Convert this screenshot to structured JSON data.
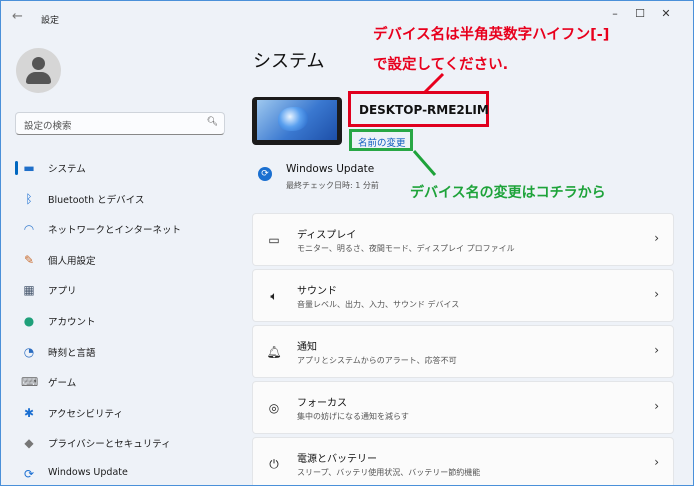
{
  "window": {
    "title": "設定",
    "controls": [
      "–",
      "☐",
      "✕"
    ]
  },
  "sidebar": {
    "search_placeholder": "設定の検索",
    "items": [
      {
        "label": "システム",
        "icon": "monitor-icon",
        "active": true
      },
      {
        "label": "Bluetooth とデバイス",
        "icon": "bluetooth-icon"
      },
      {
        "label": "ネットワークとインターネット",
        "icon": "wifi-icon"
      },
      {
        "label": "個人用設定",
        "icon": "brush-icon"
      },
      {
        "label": "アプリ",
        "icon": "apps-icon"
      },
      {
        "label": "アカウント",
        "icon": "account-icon"
      },
      {
        "label": "時刻と言語",
        "icon": "globe-clock-icon"
      },
      {
        "label": "ゲーム",
        "icon": "gamepad-icon"
      },
      {
        "label": "アクセシビリティ",
        "icon": "accessibility-icon"
      },
      {
        "label": "プライバシーとセキュリティ",
        "icon": "shield-icon"
      },
      {
        "label": "Windows Update",
        "icon": "update-icon"
      }
    ]
  },
  "main": {
    "title": "システム",
    "device_name": "DESKTOP-RME2LIM",
    "rename_link": "名前の変更",
    "windows_update": {
      "title": "Windows Update",
      "subtitle": "最終チェック日時: 1 分前"
    },
    "cards": [
      {
        "title": "ディスプレイ",
        "subtitle": "モニター、明るさ、夜間モード、ディスプレイ プロファイル",
        "icon": "display-icon"
      },
      {
        "title": "サウンド",
        "subtitle": "音量レベル、出力、入力、サウンド デバイス",
        "icon": "speaker-icon"
      },
      {
        "title": "通知",
        "subtitle": "アプリとシステムからのアラート、応答不可",
        "icon": "bell-icon"
      },
      {
        "title": "フォーカス",
        "subtitle": "集中の妨げになる通知を減らす",
        "icon": "focus-icon"
      },
      {
        "title": "電源とバッテリー",
        "subtitle": "スリープ、バッテリ使用状況、バッテリー節約機能",
        "icon": "power-icon"
      }
    ]
  },
  "annotations": {
    "red_line1": "デバイス名は半角英数字ハイフン[-]",
    "red_line2": "で設定してください.",
    "green": "デバイス名の変更はコチラから"
  },
  "colors": {
    "accent": "#0067c0",
    "annotation_red": "#e8001d",
    "annotation_green": "#1ea33a"
  }
}
